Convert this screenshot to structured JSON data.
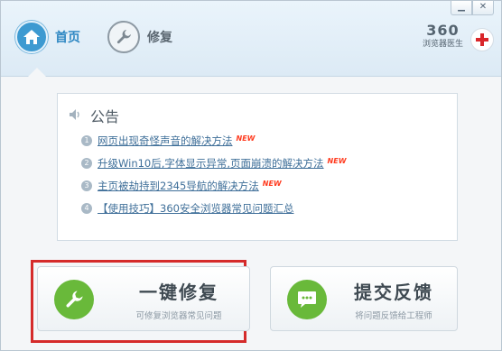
{
  "window": {
    "minimize_icon": "minimize-icon",
    "close_icon": "close-icon"
  },
  "nav": {
    "home": {
      "label": "首页",
      "icon": "home-icon"
    },
    "repair": {
      "label": "修复",
      "icon": "wrench-icon"
    }
  },
  "brand": {
    "number": "360",
    "name": "浏览器医生",
    "icon": "red-cross-icon"
  },
  "notice": {
    "title": "公告",
    "icon": "speaker-icon",
    "items": [
      {
        "num": "1",
        "text": "网页出现奇怪声音的解决方法",
        "badge": "NEW"
      },
      {
        "num": "2",
        "text": "升级Win10后,字体显示异常,页面崩溃的解决方法",
        "badge": "NEW"
      },
      {
        "num": "3",
        "text": "主页被劫持到2345导航的解决方法",
        "badge": "NEW"
      },
      {
        "num": "4",
        "text": "【使用技巧】360安全浏览器常见问题汇总",
        "badge": ""
      }
    ]
  },
  "actions": {
    "repair": {
      "title": "一键修复",
      "subtitle": "可修复浏览器常见问题",
      "icon": "wrench-icon"
    },
    "feedback": {
      "title": "提交反馈",
      "subtitle": "将问题反馈给工程师",
      "icon": "chat-bubble-icon"
    }
  },
  "colors": {
    "accent": "#3d9ad1",
    "green": "#69b93a",
    "new_badge": "#ff3b1f",
    "highlight": "#d52b2b"
  }
}
